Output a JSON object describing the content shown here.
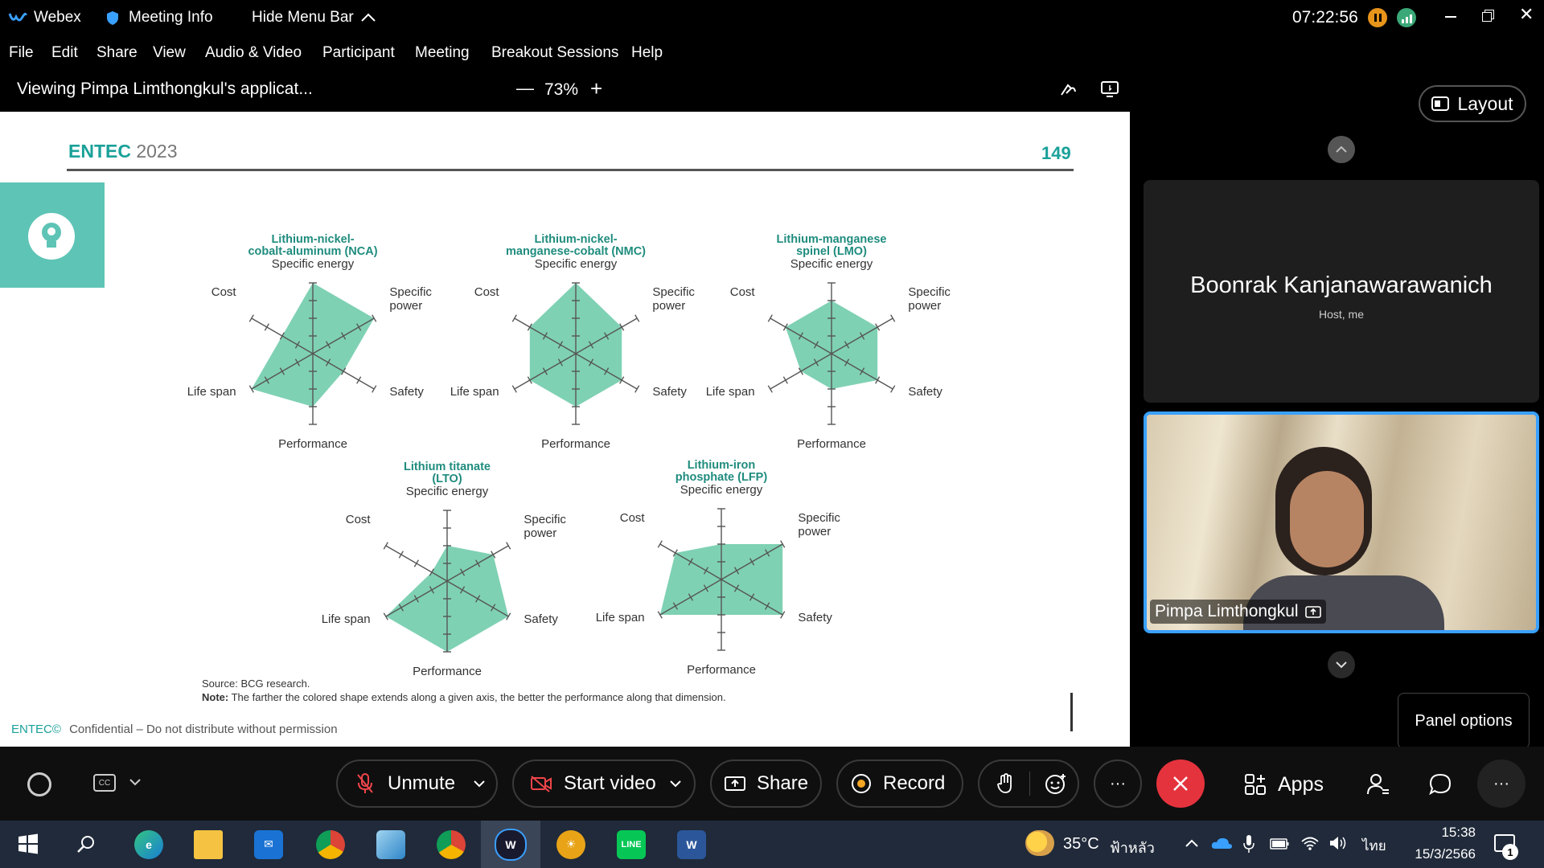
{
  "titlebar": {
    "app": "Webex",
    "meeting_info": "Meeting Info",
    "hide_menu": "Hide Menu Bar",
    "time": "07:22:56"
  },
  "menu": [
    "File",
    "Edit",
    "Share",
    "View",
    "Audio & Video",
    "Participant",
    "Meeting",
    "Breakout Sessions",
    "Help"
  ],
  "sharebar": {
    "viewing": "Viewing Pimpa Limthongkul's applicat...",
    "zoom": "73%",
    "zoom_out": "—",
    "zoom_in": "+"
  },
  "slide": {
    "brand": "ENTEC",
    "year": "2023",
    "page": "149",
    "source_label": "Source:",
    "source": "BCG research.",
    "note_label": "Note:",
    "note": "The farther the colored shape extends along a given axis, the better the performance along that dimension.",
    "footer_brand": "ENTEC©",
    "footer": "Confidential – Do not distribute without permission",
    "accent_color": "#5ec4b6",
    "fill_color": "#7fd1b4"
  },
  "chart_data": [
    {
      "type": "radar",
      "title_lines": [
        "Lithium-nickel-",
        "cobalt-aluminum (NCA)"
      ],
      "axes": [
        "Specific energy",
        "Specific power",
        "Safety",
        "Performance",
        "Life span",
        "Cost"
      ],
      "values": [
        4,
        4,
        2,
        3,
        4,
        2
      ],
      "max": 4
    },
    {
      "type": "radar",
      "title_lines": [
        "Lithium-nickel-",
        "manganese-cobalt (NMC)"
      ],
      "axes": [
        "Specific energy",
        "Specific power",
        "Safety",
        "Performance",
        "Life span",
        "Cost"
      ],
      "values": [
        4,
        3,
        3,
        3,
        3,
        3
      ],
      "max": 4
    },
    {
      "type": "radar",
      "title_lines": [
        "Lithium-manganese",
        "spinel (LMO)"
      ],
      "axes": [
        "Specific energy",
        "Specific power",
        "Safety",
        "Performance",
        "Life span",
        "Cost"
      ],
      "values": [
        3,
        3,
        3,
        2,
        2,
        3
      ],
      "max": 4
    },
    {
      "type": "radar",
      "title_lines": [
        "Lithium titanate",
        "(LTO)"
      ],
      "axes": [
        "Specific energy",
        "Specific power",
        "Safety",
        "Performance",
        "Life span",
        "Cost"
      ],
      "values": [
        2,
        3,
        4,
        4,
        4,
        1
      ],
      "max": 4
    },
    {
      "type": "radar",
      "title_lines": [
        "Lithium-iron",
        "phosphate (LFP)"
      ],
      "axes": [
        "Specific energy",
        "Specific power",
        "Safety",
        "Performance",
        "Life span",
        "Cost"
      ],
      "values": [
        2,
        4,
        4,
        2,
        4,
        3
      ],
      "max": 4
    }
  ],
  "panel": {
    "layout_label": "Layout",
    "host_name": "Boonrak Kanjanawarawanich",
    "host_role": "Host, me",
    "participant": "Pimpa Limthongkul",
    "panel_options": "Panel options"
  },
  "controls": {
    "unmute": "Unmute",
    "start_video": "Start video",
    "share": "Share",
    "record": "Record",
    "apps": "Apps",
    "more": "···"
  },
  "taskbar": {
    "temp": "35°C",
    "weather": "ฟ้าหลัว",
    "lang": "ไทย",
    "clock": "15:38",
    "date": "15/3/2566",
    "notif_count": "1"
  }
}
